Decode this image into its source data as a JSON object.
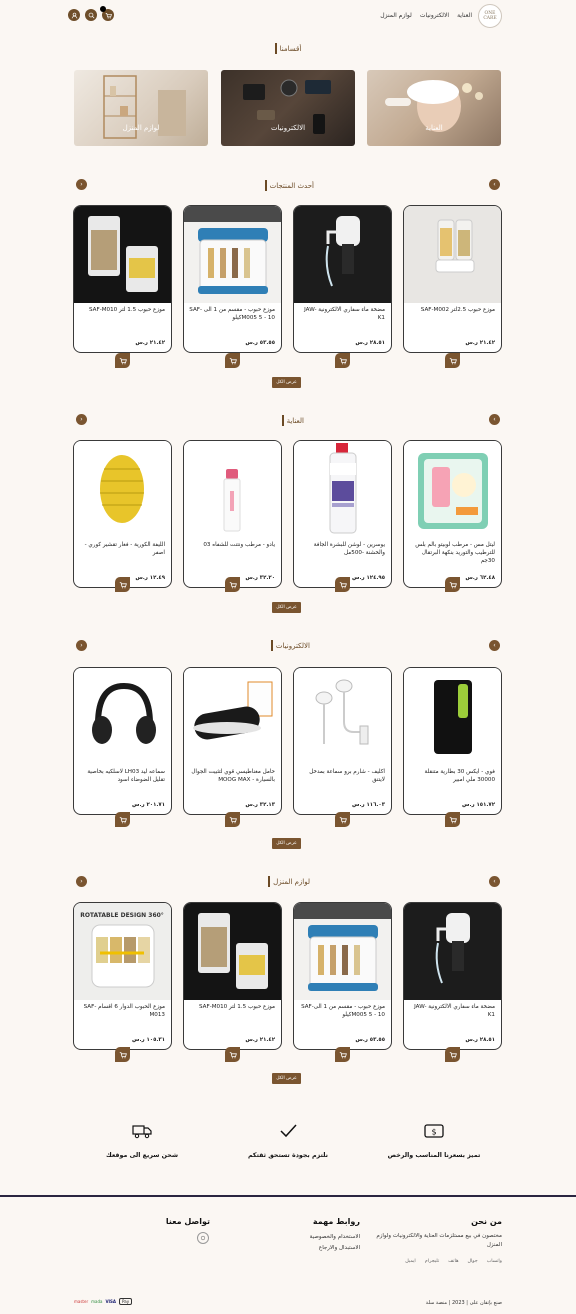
{
  "header": {
    "logo_text": "ONE CARE",
    "nav": [
      "العناية",
      "الالكترونيات",
      "لوازم المنزل"
    ],
    "icons": [
      "user-icon",
      "search-icon",
      "cart-icon"
    ]
  },
  "categories_section": {
    "title": "أقسامنا",
    "items": [
      {
        "label": "العناية"
      },
      {
        "label": "الالكترونيات"
      },
      {
        "label": "لوازم المنزل"
      }
    ]
  },
  "latest": {
    "title": "أحدث المنتجات",
    "show_all": "عرض الكل",
    "products": [
      {
        "name": "موزع حبوب 2.5لتر SAF-M002",
        "price": "٢١.٤٢ ر.س"
      },
      {
        "name": "مضخة ماء سفاري الالكترونية JAW-K1",
        "price": "٢٨.٥١ ر.س"
      },
      {
        "name": "موزع حبوب - مقسم من 1 الى SAF-M005 5 - 10كيلو",
        "price": "٥٣.٥٥ ر.س"
      },
      {
        "name": "موزع حبوب 1.5 لتر SAF-M010",
        "price": "٢١.٤٢ ر.س"
      }
    ]
  },
  "care": {
    "title": "العناية",
    "show_all": "عرض الكل",
    "products": [
      {
        "name": "ليتل مس - مرطب لوبيتو بالم بلس للترطيب والتوريد بنكهة البرتقال 30جم",
        "price": "٦٢.٤٨ ر.س"
      },
      {
        "name": "يوسرين - لوشن للبشرة الجافة والخشنة -500مل",
        "price": "١٢٤.٩٥ ر.س"
      },
      {
        "name": "يادو - مرطب ونتنت للشفاه 03",
        "price": "٣٢.٢٠ ر.س"
      },
      {
        "name": "الليفة الكورية - فغار تقشير كوري - اصفر",
        "price": "١٢.٤٩ ر.س"
      }
    ]
  },
  "electronics": {
    "title": "الالكترونيات",
    "show_all": "عرض الكل",
    "products": [
      {
        "name": "فوي - ايكس 30 بطارية متنقلة 30000 ملي امبير",
        "price": "١٥١.٧٢ ر.س"
      },
      {
        "name": "اكليف - شارم برو سماعة بمدخل لايتنق",
        "price": "١١٦.٠٣ ر.س"
      },
      {
        "name": "حامل مغناطيسي قوي لتثبيت الجوال بالسيارة - MOOG MAX",
        "price": "٣٢.١٣ ر.س"
      },
      {
        "name": "سماعه ليد LH03 لاسلكيه بخاصية تقليل الضوضاء اسود",
        "price": "٢٠١.٧١ ر.س"
      }
    ]
  },
  "home": {
    "title": "لوازم المنزل",
    "show_all": "عرض الكل",
    "products": [
      {
        "name": "مضخة ماء سفاري الالكترونية JAW-K1",
        "price": "٢٨.٥١ ر.س"
      },
      {
        "name": "موزع حبوب - مقسم من 1 الىSAF-M005 5 - 10كيلو",
        "price": "٥٣.٥٥ ر.س"
      },
      {
        "name": "موزع حبوب 1.5 لتر SAF-M010",
        "price": "٢١.٤٢ ر.س"
      },
      {
        "name": "موزع الحبوب الدوار 6 اقسام SAF-M013",
        "price": "١٠٥.٣١ ر.س"
      }
    ],
    "image_text": "360° ROTATABLE DESIGN"
  },
  "features": [
    {
      "title": "تميز بسعرنا المناسب والرخص",
      "icon": "money-icon"
    },
    {
      "title": "نلتزم بجودة تستحق ثقتكم",
      "icon": "check-icon"
    },
    {
      "title": "شحن سريع الى موقعك",
      "icon": "truck-icon"
    }
  ],
  "footer": {
    "about_title": "من نحن",
    "about_text": "مختصون في بيع مستلزمات العناية والالكترونيات ولوازم المنزل",
    "contacts": [
      "واتساب",
      "جوال",
      "هاتف",
      "تليجرام",
      "ايميل"
    ],
    "links_title": "روابط مهمة",
    "links": [
      "الاستخدام والخصوصية",
      "الاستبدال والارجاع"
    ],
    "contact_title": "تواصل معنا",
    "copyright": "صنع بإتقان على  |  2023  |  منصة سلة",
    "payments": [
      "Pay",
      "VISA",
      "mada",
      "master"
    ]
  },
  "colors": {
    "accent": "#7a5530",
    "background": "#fbf7f3"
  }
}
